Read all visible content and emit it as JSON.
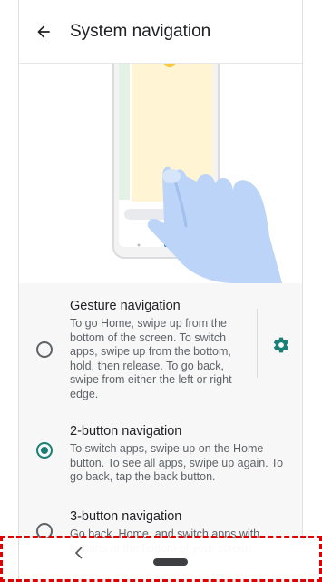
{
  "toolbar": {
    "back_icon": "arrow-left-icon",
    "title": "System navigation"
  },
  "options": [
    {
      "title": "Gesture navigation",
      "description": "To go Home, swipe up from the bottom of the screen. To switch apps, swipe up from the bottom, hold, then release. To go back, swipe from either the left or right edge.",
      "selected": false,
      "settings_icon": "gear-icon"
    },
    {
      "title": "2-button navigation",
      "description": "To switch apps, swipe up on the Home button. To see all apps, swipe up again. To go back, tap the back button.",
      "selected": true
    },
    {
      "title": "3-button navigation",
      "description": "Go back, Home, and switch apps with buttons at the bottom of your screen.",
      "selected": false
    }
  ],
  "navbar": {
    "back_icon": "chevron-left-icon",
    "home_icon": "home-pill-icon"
  },
  "colors": {
    "accent": "#1a7f76",
    "highlight_border": "#e00000"
  }
}
